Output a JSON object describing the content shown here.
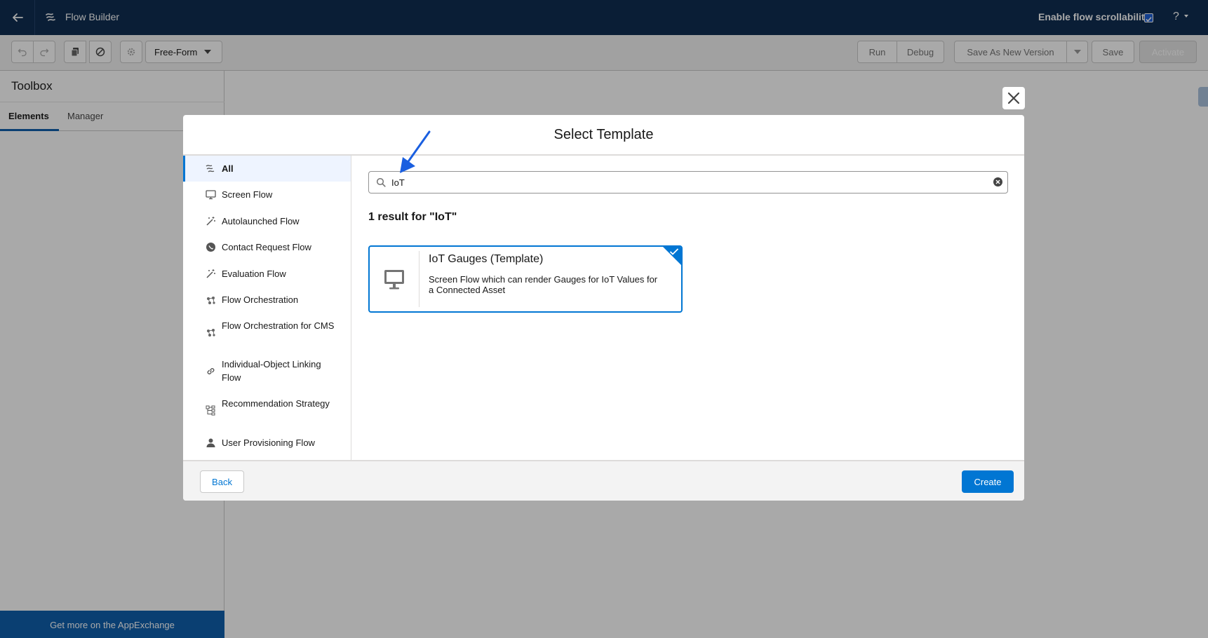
{
  "header": {
    "app_title": "Flow Builder",
    "scroll_label": "Enable flow scrollability",
    "scroll_enabled": true,
    "help_label": "?"
  },
  "toolbar": {
    "mode": "Free-Form",
    "run": "Run",
    "debug": "Debug",
    "save_as_new_version": "Save As New Version",
    "save": "Save",
    "activate": "Activate"
  },
  "toolbox": {
    "title": "Toolbox",
    "tabs": [
      "Elements",
      "Manager"
    ],
    "active_tab": "Elements",
    "appexchange_link": "Get more on the AppExchange"
  },
  "modal": {
    "title": "Select Template",
    "categories": [
      {
        "label": "All",
        "icon": "flow-icon",
        "selected": true
      },
      {
        "label": "Screen Flow",
        "icon": "desktop-icon"
      },
      {
        "label": "Autolaunched Flow",
        "icon": "magic-wand-icon"
      },
      {
        "label": "Contact Request Flow",
        "icon": "contact-request-icon"
      },
      {
        "label": "Evaluation Flow",
        "icon": "magic-wand-icon"
      },
      {
        "label": "Flow Orchestration",
        "icon": "orchestration-icon"
      },
      {
        "label": "Flow Orchestration for CMS",
        "icon": "orchestration-icon"
      },
      {
        "label": "Individual-Object Linking Flow",
        "icon": "link-icon"
      },
      {
        "label": "Recommendation Strategy",
        "icon": "strategy-icon"
      },
      {
        "label": "User Provisioning Flow",
        "icon": "user-icon"
      }
    ],
    "search": {
      "value": "IoT"
    },
    "result_count": "1 result for \"IoT\"",
    "results": [
      {
        "title": "IoT Gauges (Template)",
        "description": "Screen Flow which can render Gauges for IoT Values for a Connected Asset",
        "icon": "desktop-icon",
        "selected": true
      }
    ],
    "footer": {
      "back": "Back",
      "create": "Create"
    }
  },
  "colors": {
    "header_bg": "#0b2a4f",
    "brand_blue": "#0176d3",
    "annotation_arrow": "#1a5fe0"
  }
}
